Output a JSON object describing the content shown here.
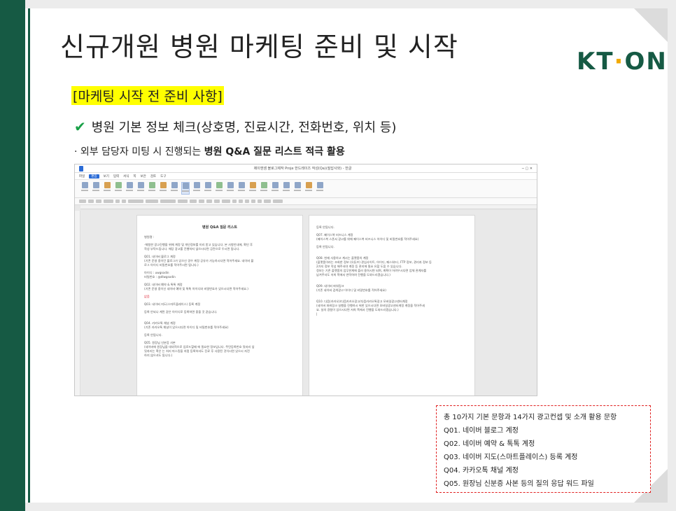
{
  "slide": {
    "title": "신규개원 병원 마케팅 준비 및 시작",
    "logo": {
      "part1": "KT",
      "dot": "·",
      "part2": "ON"
    },
    "section_heading": "[마케팅 시작 전 준비 사항]",
    "check_item": "병원 기본 정보 체크(상호명, 진료시간, 전화번호, 위치 등)",
    "bullet_prefix": "· 외부 담당자 미팅 시 진행되는 ",
    "bullet_bold": "병원 Q&A 질문 리스트 적극 활용",
    "colors": {
      "brand_green": "#165a44",
      "highlight": "#ffff00",
      "check": "#18a047",
      "callout_border": "#e02020"
    }
  },
  "screenshot": {
    "window_title": "제이앤샘 블로그제작 Proje 한드레이즈 작성(Qa)(질답사와) - 한글",
    "menus": [
      "파일",
      "편집",
      "보기",
      "입력",
      "서식",
      "쪽",
      "보안",
      "검토",
      "도구"
    ],
    "active_menu": "편집",
    "page1": {
      "title": "병원 Q&A 질문 리스트",
      "lines": [
        {
          "t": "병원명 :",
          "c": ""
        },
        {
          "t": "",
          "c": ""
        },
        {
          "t": "-체험한 광고진행을 위해 계정 및 개인정보를 미리 받고 있습니다. 본 사항안내에, 확인 후",
          "c": ""
        },
        {
          "t": "작성 부탁드립니다. 해당 광고를 진행하지 않으시다면 공란으로 두시면 됩니다.",
          "c": ""
        },
        {
          "t": "",
          "c": ""
        },
        {
          "t": "Q01. 네이버 블로그 계정",
          "c": ""
        },
        {
          "t": "(기존 운영 중이던 블로그가 있으신 경우 계정 공유가 가능하시다면 적어주세요. 네이버 블",
          "c": ""
        },
        {
          "t": "로그 아이디 비밀번호를 적어주시면 됩니다.)",
          "c": ""
        },
        {
          "t": "",
          "c": ""
        },
        {
          "t": "아이디 : uwgsodin",
          "c": ""
        },
        {
          "t": "비밀번호 : @dlwgsodin",
          "c": ""
        },
        {
          "t": "",
          "c": ""
        },
        {
          "t": "Q02. 네이버 예약 & 톡톡 계정",
          "c": ""
        },
        {
          "t": "(기존 운영 중이신 네이버 예약 및 톡톡 아이디와 비밀번호가 있으시다면 적어주세요.)",
          "c": ""
        },
        {
          "t": "",
          "c": ""
        },
        {
          "t": "없음",
          "c": "red"
        },
        {
          "t": "",
          "c": ""
        },
        {
          "t": "Q03. 네이버 지도(스마트플레이스) 등록 계정",
          "c": ""
        },
        {
          "t": "",
          "c": ""
        },
        {
          "t": "등록 안되나 계된 같은 아이디로 등록하면 좋을 것 같습니다.",
          "c": ""
        },
        {
          "t": "",
          "c": ""
        },
        {
          "t": "",
          "c": ""
        },
        {
          "t": "Q04. 카카오톡 채널 계정",
          "c": ""
        },
        {
          "t": "(기존 카카오톡 채널이 있으시다면 아이디 및 비밀번호를 적어주세요)",
          "c": ""
        },
        {
          "t": "",
          "c": ""
        },
        {
          "t": "등록 안됩니다.",
          "c": ""
        },
        {
          "t": "",
          "c": ""
        },
        {
          "t": "Q05. 원장님 신분증 사본",
          "c": ""
        },
        {
          "t": "(네이버에 원장님을 대외적으로 업로드할때 에 필요한 정보입니다. 주민등록번호 뒷자리 앞",
          "c": ""
        },
        {
          "t": "뒷자리는 혹은 는 처리 마스킹을 처럼 등록하셔도 진료 후 사용된 것이시면 있으시 자전",
          "c": ""
        },
        {
          "t": "하지 않으셔도 됩니다.)",
          "c": ""
        }
      ]
    },
    "page2": {
      "lines": [
        {
          "t": "등록 안됩니다.",
          "c": ""
        },
        {
          "t": "",
          "c": ""
        },
        {
          "t": "Q07. 페이스북 비즈니스 계정",
          "c": ""
        },
        {
          "t": "(페이스북 스폰서 광고를 위해 페이스북 비즈니스 아이디 및 비밀번호를 적어주세요)",
          "c": ""
        },
        {
          "t": "",
          "c": ""
        },
        {
          "t": "등록 안됩니다.",
          "c": ""
        },
        {
          "t": "",
          "c": ""
        },
        {
          "t": "",
          "c": ""
        },
        {
          "t": "Q08. 현재 사용하고 계시는 플랫폼의 계정",
          "c": ""
        },
        {
          "t": "(플랫폼이라는 조회한 정보 (유튜브) 관심사이트, 아이디, 패스워드), FTP 정보, 관리자 정보 등",
          "c": ""
        },
        {
          "t": "2가지 정보 작성 해주셔야 계정 등 관리에 필요 유할 도움 수 있습니다.",
          "c": ""
        },
        {
          "t": "정보는 기존 플랫폼의 업무한계에 플러 용하시면 되며, 계획이 어려우시다면 업체 관계자를",
          "c": ""
        },
        {
          "t": "남겨주셔도 저희 쪽에서 연락하여 진행을 도와드리겠습니다.)",
          "c": ""
        },
        {
          "t": "",
          "c": ""
        },
        {
          "t": "",
          "c": ""
        },
        {
          "t": "Q09. 네이버 파워링크",
          "c": ""
        },
        {
          "t": "(기존 네이버 검색광고 아이디 및 비밀번호를 적어주세요)",
          "c": ""
        },
        {
          "t": "",
          "c": ""
        },
        {
          "t": "",
          "c": ""
        },
        {
          "t": "Q10. 다음(카카오)/다음카카오광고/다음카카오톡광고 모바일광고센터계정",
          "c": ""
        },
        {
          "t": "(네이버 파워링크 실행을 진행하시 위한 있으시다면 모바일광고센터계정 계정을 적어주세",
          "c": ""
        },
        {
          "t": "요. 실의 경험이 있으시다면 저희 쪽에서 진행을 도와드리겠습니다.)",
          "c": ""
        },
        {
          "t": "|",
          "c": ""
        }
      ]
    }
  },
  "callout": {
    "lines": [
      "총 10가지 기본 문항과 14가지 광고컨셉 및 소개 활용 문항",
      "Q01. 네이버 블로그 계정",
      "Q02. 네이버 예약 & 톡톡 계정",
      "Q03. 네이버 지도(스마트플레이스) 등록 계정",
      "Q04. 카카오톡 채널 계정",
      "Q05. 원장님 신분증 사본 등의 질의 응답 워드 파일"
    ]
  }
}
